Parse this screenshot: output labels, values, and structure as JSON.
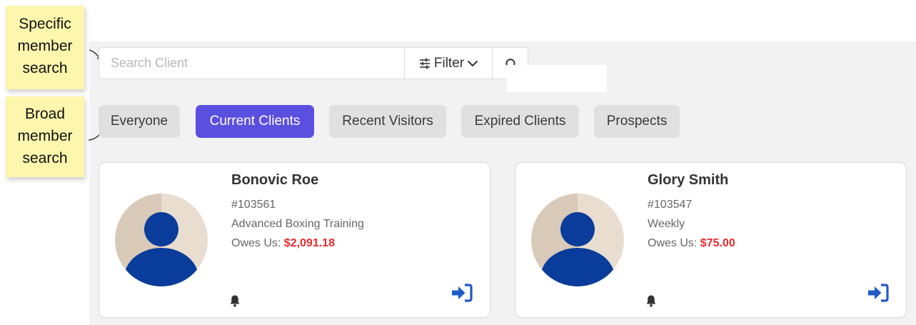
{
  "annotations": {
    "specific": [
      "Specific",
      "member",
      "search"
    ],
    "broad": [
      "Broad",
      "member",
      "search"
    ]
  },
  "search": {
    "placeholder": "Search Client",
    "value": "",
    "filter_label": "Filter"
  },
  "filters": [
    {
      "label": "Everyone",
      "active": false
    },
    {
      "label": "Current Clients",
      "active": true
    },
    {
      "label": "Recent Visitors",
      "active": false
    },
    {
      "label": "Expired Clients",
      "active": false
    },
    {
      "label": "Prospects",
      "active": false
    }
  ],
  "clients": [
    {
      "name": "Bonovic Roe",
      "id": "#103561",
      "plan": "Advanced Boxing Training",
      "owes_label": "Owes Us:",
      "owes_amount": "$2,091.18"
    },
    {
      "name": "Glory Smith",
      "id": "#103547",
      "plan": "Weekly",
      "owes_label": "Owes Us:",
      "owes_amount": "$75.00"
    }
  ],
  "colors": {
    "active_chip": "#5b4fe0",
    "chip": "#e0e0e0",
    "owes": "#e8282c",
    "avatar_figure": "#0a3d9b",
    "login_icon": "#1f5bc6",
    "note": "#fdf6ad"
  },
  "icons": {
    "filter": "sliders-icon",
    "dropdown": "chevron-down-icon",
    "refresh": "refresh-icon",
    "notification": "bell-icon",
    "check_in": "sign-in-icon"
  }
}
